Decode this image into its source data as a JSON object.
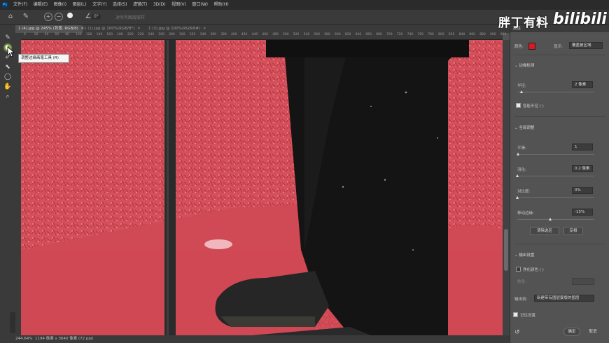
{
  "app": {
    "logo": "Ps"
  },
  "menu": [
    "文件(F)",
    "编辑(E)",
    "图像(I)",
    "图层(L)",
    "文字(Y)",
    "选择(S)",
    "滤镜(T)",
    "3D(D)",
    "视图(V)",
    "窗口(W)",
    "帮助(H)"
  ],
  "options": {
    "angle": "0°",
    "sample_all": "对所有图层取样"
  },
  "tabs": [
    {
      "label": "1 (4).jpg @ 245% (背景, RGB/8)",
      "active": true
    },
    {
      "label": "1 (1).jpg @ 100%(RGB/8*)",
      "active": false
    },
    {
      "label": "1 (3).jpg @ 100%(RGB/8#)",
      "active": false
    }
  ],
  "ruler_ticks": [
    "0",
    "20",
    "40",
    "60",
    "80",
    "100",
    "120",
    "140",
    "160",
    "180",
    "200",
    "220",
    "240",
    "260",
    "280",
    "300",
    "320",
    "340",
    "360",
    "380",
    "400",
    "420",
    "440",
    "460",
    "480",
    "500",
    "520",
    "540",
    "560",
    "580",
    "600",
    "620",
    "640",
    "660",
    "680",
    "700",
    "720",
    "740",
    "760",
    "780",
    "800",
    "820",
    "840",
    "860",
    "880",
    "900",
    "920"
  ],
  "tooltip": "调整边缘画笔工具 (R)",
  "status": {
    "zoom": "244.64%",
    "dimensions": "1194 像素 x 3640 像素 (72 ppi)"
  },
  "panel": {
    "title": "属性",
    "color_label": "颜色:",
    "color_value": "#e0151f",
    "display_label": "显示:",
    "display_value": "覆盖被区域",
    "edge_section": "边缘检测",
    "radius_label": "半径:",
    "radius_value": "2 像素",
    "radius_level": 0.05,
    "smart_radius": "智能半径 ( )",
    "global_section": "全局调整",
    "smooth_label": "平滑:",
    "smooth_value": "1",
    "smooth_level": 0.01,
    "feather_label": "羽化:",
    "feather_value": "0.2 像素",
    "feather_level": 0.001,
    "contrast_label": "对比度:",
    "contrast_value": "0%",
    "contrast_level": 0,
    "shift_label": "移动边缘:",
    "shift_value": "-15%",
    "shift_level": 0.425,
    "clear_btn": "清除选区",
    "invert_btn": "反相",
    "output_section": "输出设置",
    "decontam": "净化颜色 ( )",
    "amount_label": "数量:",
    "output_to_label": "输出到:",
    "output_to_value": "新建带有图层蒙版的图层",
    "remember": "记住设置",
    "ok": "确定",
    "cancel": "取消"
  },
  "watermark": {
    "text": "胖丁有料",
    "brand": "bilibili"
  }
}
